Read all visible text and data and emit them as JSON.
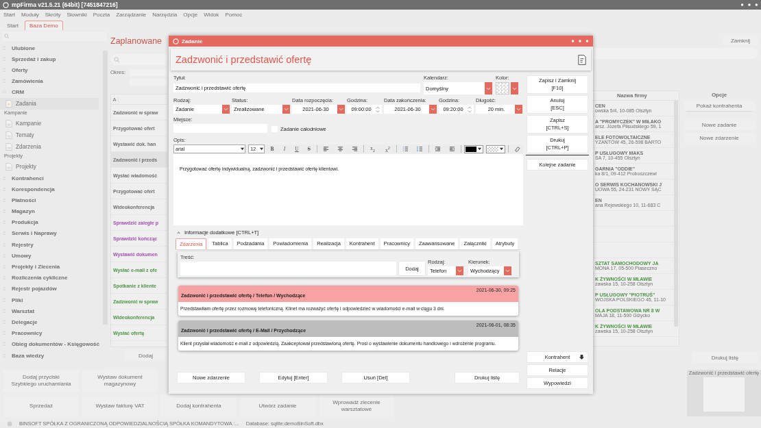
{
  "app": {
    "title": "mpFirma v21.5.21 (64bit) [7451847216]"
  },
  "menu": [
    "Start",
    "Moduły",
    "Skróty",
    "Słowniki",
    "Poczta",
    "Zarządzanie",
    "Narzędzia",
    "Opcje",
    "Widok",
    "Pomoc"
  ],
  "doc_tabs": [
    {
      "label": "Start",
      "selected": false
    },
    {
      "label": "Baza Demo",
      "selected": true
    }
  ],
  "sidebar": {
    "groups": [
      {
        "label": "Ulubione",
        "expanded": false
      },
      {
        "label": "Sprzedaż i zakup",
        "expanded": false
      },
      {
        "label": "Oferty",
        "expanded": false
      },
      {
        "label": "Zamówienia",
        "expanded": false
      },
      {
        "label": "CRM",
        "expanded": true,
        "children": [
          {
            "kind": "item",
            "label": "Zadania",
            "selected": true
          },
          {
            "kind": "heading",
            "label": "Kampanie",
            "children": [
              {
                "kind": "item",
                "label": "Kampanie",
                "selected": false
              },
              {
                "kind": "item",
                "label": "Tematy",
                "selected": false
              },
              {
                "kind": "item",
                "label": "Zdarzenia",
                "selected": false
              }
            ]
          },
          {
            "kind": "heading",
            "label": "Projekty",
            "children": [
              {
                "kind": "item",
                "label": "Projekty",
                "selected": false
              }
            ]
          }
        ]
      },
      {
        "label": "Kontrahenci",
        "expanded": false
      },
      {
        "label": "Korespondencja",
        "expanded": false
      },
      {
        "label": "Płatności",
        "expanded": false
      },
      {
        "label": "Magazyn",
        "expanded": false
      },
      {
        "label": "Produkcja",
        "expanded": false
      },
      {
        "label": "Serwis i Naprawy",
        "expanded": false
      },
      {
        "label": "Rejestry",
        "expanded": false
      },
      {
        "label": "Umowy",
        "expanded": false
      },
      {
        "label": "Projekty i Zlecenia",
        "expanded": false
      },
      {
        "label": "Rozliczenia cykliczne",
        "expanded": false
      },
      {
        "label": "Rejestr pojazdów",
        "expanded": false
      },
      {
        "label": "Pliki",
        "expanded": false
      },
      {
        "label": "Warsztat",
        "expanded": false
      },
      {
        "label": "Delegacje",
        "expanded": false
      },
      {
        "label": "Pracownicy",
        "expanded": false
      },
      {
        "label": "Obieg dokumentów - Księgowość",
        "expanded": false
      },
      {
        "label": "Baza wiedzy",
        "expanded": false
      }
    ]
  },
  "tasks_view": {
    "heading": "Zaplanowane",
    "period_label": "Okres:",
    "column_1": "A",
    "add_button": "Dodaj",
    "rows": [
      {
        "text": "Zadzwonić w spraw",
        "color": "#6e6e6e",
        "selected": false
      },
      {
        "text": "Przygotować ofert",
        "color": "#6e6e6e",
        "selected": false
      },
      {
        "text": "Wystawić dok. han",
        "color": "#6e6e6e",
        "selected": false
      },
      {
        "text": "Zadzwonić i przeds",
        "color": "#6e6e6e",
        "selected": true
      },
      {
        "text": "Wysłać wiadomość",
        "color": "#6e6e6e",
        "selected": false
      },
      {
        "text": "Przygotować ofert",
        "color": "#6e6e6e",
        "selected": false
      },
      {
        "text": "Wideokonferencja",
        "color": "#6e6e6e",
        "selected": false
      },
      {
        "text": "Sprawdzić zaległe p",
        "color": "#a04fae",
        "selected": false
      },
      {
        "text": "Sprawdzić kończąc",
        "color": "#a04fae",
        "selected": false
      },
      {
        "text": "Wystawić dokumen",
        "color": "#a04fae",
        "selected": false
      },
      {
        "text": "Wysłać e-mail z ofe",
        "color": "#4b9444",
        "selected": false
      },
      {
        "text": "Spotkanie z kliente",
        "color": "#4b9444",
        "selected": false
      },
      {
        "text": "Zadzwonić w spraw",
        "color": "#4b9444",
        "selected": false
      },
      {
        "text": "Wideokonferencja",
        "color": "#4b9444",
        "selected": false
      },
      {
        "text": "Wysłać ofertę",
        "color": "#4b9444",
        "selected": false
      }
    ],
    "close_button": "Zamknij",
    "company_column": "Nazwa firmy",
    "companies": [
      {
        "kind": "company",
        "name": "CEN",
        "address": "owska 5/4, 10-085 Olsztyn",
        "color": "#6e6e6e"
      },
      {
        "kind": "company",
        "name": "A \"PROMYCZEK\" W MIŁAKO",
        "address": "arsz. Józefa Piłsudskiego 59, 1",
        "color": "#6e6e6e"
      },
      {
        "kind": "company",
        "name": "ELE FOTOWOLTAICZNE",
        "address": "YZANTÓW 45, 26-598 BARTO",
        "color": "#6e6e6e"
      },
      {
        "kind": "company",
        "name": "P USŁUGOWY MAKS",
        "address": "SA 7, 10-455 Olsztyn",
        "color": "#6e6e6e"
      },
      {
        "kind": "company",
        "name": "GARNIA \"ODDIE\"",
        "address": "ka 8/1, 09-412 Proboszczewi",
        "color": "#6e6e6e"
      },
      {
        "kind": "company",
        "name": "O SERWIS KOCHANOWSKI J",
        "address": "UOWA 55, 24-231 NOWY SĄC",
        "color": "#6e6e6e"
      },
      {
        "kind": "company",
        "name": "EN",
        "address": "ana Rejewskiego 10, 11-683 C",
        "color": "#6e6e6e"
      },
      {
        "kind": "empty"
      },
      {
        "kind": "empty"
      },
      {
        "kind": "empty"
      },
      {
        "kind": "company",
        "name": "SZTAT SAMOCHODOWY JA",
        "address": "MONA 17, 05-500 Piaseczno",
        "color": "#4b9444"
      },
      {
        "kind": "company",
        "name": "K ŻYWNOŚCI W MŁAWIE",
        "address": "zawska 15, 10-258 Olsztyn",
        "color": "#4b9444"
      },
      {
        "kind": "company",
        "name": "P USŁUGOWY \"PIOTRUŚ\"",
        "address": "WOJSKA POLSKIEGO 45, 11-10",
        "color": "#4b9444"
      },
      {
        "kind": "company",
        "name": "OLA PODSTAWOWA NR 8 W",
        "address": "MAJA 18, 11-500 Giżycko",
        "color": "#4b9444"
      },
      {
        "kind": "company",
        "name": "K ŻYWNOŚCI W MŁAWIE",
        "address": "zawska 15, 10-258 Olsztyn",
        "color": "#4b9444"
      }
    ],
    "options": {
      "title": "Opcje",
      "buttons": [
        "Pokaż kontrahenta",
        "Nowe zadanie",
        "Nowe zdarzenie"
      ]
    },
    "print_button": "Drukuj listę",
    "preview_title": "Zadzwonić i przedstawić ofertę"
  },
  "quick_buttons": [
    [
      "Dodaj przyciski",
      "Szybkiego uruchamiania"
    ],
    [
      "Wystaw dokument",
      "magazynowy"
    ],
    [
      "Sprzedaż"
    ],
    [
      "Wystaw fakturę VAT"
    ],
    [
      "Dodaj kontrahenta"
    ],
    [
      "Utwórz zadanie"
    ],
    [
      "Wprowadź zlecenie",
      "warsztatowe"
    ]
  ],
  "status_bar": {
    "company": "BINSOFT SPÓŁKA Z OGRANICZONĄ ODPOWIEDZIALNOŚCIĄ SPÓŁKA KOMANDYTOWA :...",
    "database": "Database: sqlite:demoBinSoft.dbx"
  },
  "dialog": {
    "title": "Zadanie",
    "heading": "Zadzwonić i przedstawić ofertę",
    "title_field": {
      "label": "Tytuł:",
      "value": "Zadzwonić i przedstawić ofertę"
    },
    "calendar": {
      "label": "Kalendarz:",
      "value": "Domyślny"
    },
    "color_field": {
      "label": "Kolor:"
    },
    "fields": [
      {
        "kind": "select",
        "label": "Rodzaj:",
        "value": "Zadanie"
      },
      {
        "kind": "select",
        "label": "Status:",
        "value": "Zrealizowane"
      },
      {
        "kind": "date",
        "label": "Data rozpoczęcia:",
        "value": "2021-06-30"
      },
      {
        "kind": "time",
        "label": "Godzina:",
        "value": "09:00:00"
      },
      {
        "kind": "date",
        "label": "Data zakończenia:",
        "value": "2021-06-30"
      },
      {
        "kind": "time",
        "label": "Godzina:",
        "value": "09:20:00"
      },
      {
        "kind": "date",
        "label": "Długość:",
        "value": "20 min."
      }
    ],
    "place": {
      "label": "Miejsce:"
    },
    "all_day": {
      "label": "Zadanie całodniowe",
      "checked": false
    },
    "editor": {
      "label": "Opis:",
      "font": "arial",
      "size": "12",
      "format_buttons": [
        "B",
        "I",
        "U",
        "S"
      ],
      "script_buttons": [
        "x$_{2}$",
        "x$^{2}$"
      ],
      "text": "Przygotować ofertę indywidualną, zadzwonić i przedstawić ofertę klientowi."
    },
    "more_info": {
      "label": "Informacje dodatkowe [CTRL+T]",
      "expanded": true
    },
    "tabs": [
      {
        "label": "Zdarzenia",
        "selected": true
      },
      {
        "label": "Tablica",
        "selected": false
      },
      {
        "label": "Podzadania",
        "selected": false
      },
      {
        "label": "Powiadomienia",
        "selected": false
      },
      {
        "label": "Realizacja",
        "selected": false
      },
      {
        "label": "Kontrahent",
        "selected": false
      },
      {
        "label": "Pracownicy",
        "selected": false
      },
      {
        "label": "Zaawansowane",
        "selected": false
      },
      {
        "label": "Załączniki",
        "selected": false
      },
      {
        "label": "Atrybuty",
        "selected": false
      }
    ],
    "event_form": {
      "content_label": "Treść:",
      "add_button": "Dodaj",
      "type": {
        "label": "Rodzaj:",
        "value": "Telefon"
      },
      "direction": {
        "label": "Kierunek:",
        "value": "Wychodzący"
      }
    },
    "events": [
      {
        "title": "Zadzwonić i przedstawić ofertę / Telefon / Wychodzące",
        "time": "2021-06-30, 09:25",
        "body": "Przedstawiłam ofertę przez rozmowę telefoniczną. Klinet ma rozważyć ofertę i odpowiedzieć w wiadomości e-mail w ciągu 3 dni.",
        "color": "#f7a3a3"
      },
      {
        "title": "Zadzwonić i przedstawić ofertę / E-Mail / Przychodzące",
        "time": "2021-06-01, 08:35",
        "body": "Klient przysłał wiadomość e-mail z odpowiedzią. Zaakceptował przedstawioną ofertę. Prosi o wystawienie dokumentu handlowego i wdrożenie programu.",
        "color": "#bdbdbd"
      }
    ],
    "list_buttons": [
      "Nowe zdarzenie",
      "Edytuj [Enter]",
      "Usuń [Del]",
      "Drukuj listę"
    ],
    "side_buttons": [
      [
        "Zapisz i Zamknij",
        "[F10]"
      ],
      [
        "Anuluj",
        "[ESC]"
      ],
      [
        "Zapisz",
        "[CTRL+S]"
      ],
      [
        "Drukuj",
        "[CTRL+P]"
      ]
    ],
    "next_button": "Kolejne zadanie",
    "lower_buttons": [
      {
        "kind": "arrow",
        "label": "Kontrahent"
      },
      {
        "kind": "plain",
        "label": "Relacje"
      },
      {
        "kind": "plain",
        "label": "Wypowiedzi"
      }
    ]
  }
}
